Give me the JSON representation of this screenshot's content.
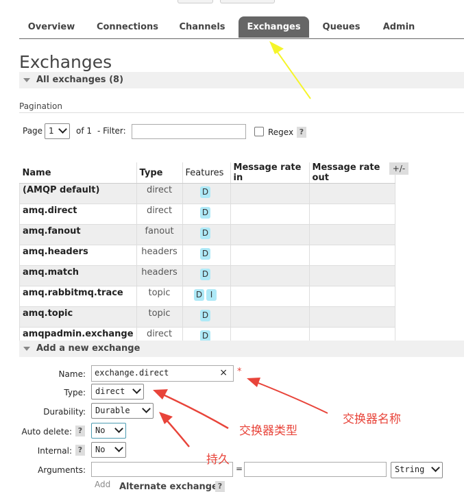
{
  "nav": {
    "tabs": [
      {
        "label": "Overview",
        "active": false
      },
      {
        "label": "Connections",
        "active": false
      },
      {
        "label": "Channels",
        "active": false
      },
      {
        "label": "Exchanges",
        "active": true
      },
      {
        "label": "Queues",
        "active": false
      },
      {
        "label": "Admin",
        "active": false
      }
    ]
  },
  "page_title": "Exchanges",
  "all_exchanges": {
    "label": "All exchanges (8)"
  },
  "pagination": {
    "label": "Pagination",
    "page_label": "Page",
    "page_value": "1",
    "of_label": "of 1",
    "filter_label": "- Filter:",
    "filter_value": "",
    "regex_label": "Regex",
    "help": "?"
  },
  "table": {
    "columns": [
      "Name",
      "Type",
      "Features",
      "Message rate in",
      "Message rate out"
    ],
    "toggle": "+/-",
    "rows": [
      {
        "name": "(AMQP default)",
        "type": "direct",
        "features": [
          "D"
        ]
      },
      {
        "name": "amq.direct",
        "type": "direct",
        "features": [
          "D"
        ]
      },
      {
        "name": "amq.fanout",
        "type": "fanout",
        "features": [
          "D"
        ]
      },
      {
        "name": "amq.headers",
        "type": "headers",
        "features": [
          "D"
        ]
      },
      {
        "name": "amq.match",
        "type": "headers",
        "features": [
          "D"
        ]
      },
      {
        "name": "amq.rabbitmq.trace",
        "type": "topic",
        "features": [
          "D",
          "I"
        ]
      },
      {
        "name": "amq.topic",
        "type": "topic",
        "features": [
          "D"
        ]
      },
      {
        "name": "amqpadmin.exchange",
        "type": "direct",
        "features": [
          "D"
        ]
      }
    ]
  },
  "add_exchange": {
    "label": "Add a new exchange",
    "name_label": "Name:",
    "name_value": "exchange.direct",
    "clear": "×",
    "required": "*",
    "type_label": "Type:",
    "type_value": "direct",
    "durability_label": "Durability:",
    "durability_value": "Durable",
    "auto_delete_label": "Auto delete:",
    "auto_delete_value": "No",
    "internal_label": "Internal:",
    "internal_value": "No",
    "arguments_label": "Arguments:",
    "arg_key": "",
    "equals": "=",
    "arg_value": "",
    "arg_type": "String",
    "add_label": "Add",
    "alternate_label": "Alternate exchange",
    "help": "?"
  },
  "annotations": {
    "name_note": "交换器名称",
    "type_note": "交换器类型",
    "durability_note": "持久",
    "arrow_red": "#e8443a",
    "arrow_yellow": "#f5f52a"
  },
  "colors": {
    "active_tab": "#666666",
    "feature_badge": "#aee9f7"
  }
}
